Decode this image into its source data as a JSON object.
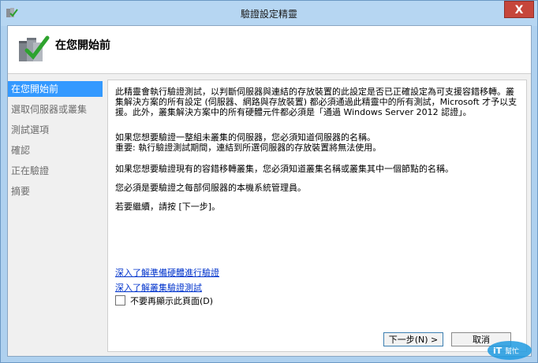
{
  "window": {
    "title": "驗證設定精靈",
    "close_label": "X"
  },
  "header": {
    "title": "在您開始前"
  },
  "nav": {
    "items": [
      {
        "label": "在您開始前"
      },
      {
        "label": "選取伺服器或叢集"
      },
      {
        "label": "測試選項"
      },
      {
        "label": "確認"
      },
      {
        "label": "正在驗證"
      },
      {
        "label": "摘要"
      }
    ]
  },
  "main": {
    "paragraph1": "此精靈會執行驗證測試，以判斷伺服器與連結的存放裝置的此設定是否已正確設定為可支援容錯移轉。叢集解決方案的所有設定 (伺服器、網路與存放裝置) 都必須通過此精靈中的所有測試，Microsoft 才予以支援。此外，叢集解決方案中的所有硬體元件都必須是「通過 Windows Server 2012 認證」。",
    "paragraph2": "如果您想要驗證一整組未叢集的伺服器，您必須知道伺服器的名稱。\n重要: 執行驗證測試期間，連結到所選伺服器的存放裝置將無法使用。",
    "paragraph3": "如果您想要驗證現有的容錯移轉叢集，您必須知道叢集名稱或叢集其中一個節點的名稱。",
    "paragraph4": "您必須是要驗證之每部伺服器的本機系統管理員。",
    "paragraph5": "若要繼續，請按 [下一步]。",
    "link1": "深入了解準備硬體進行驗證",
    "link2": "深入了解叢集驗證測試",
    "checkbox_label": "不要再顯示此頁面(D)"
  },
  "buttons": {
    "next": "下一步(N) >",
    "cancel": "取消"
  },
  "colors": {
    "frame": "#afd1ef",
    "nav_active": "#3399ff",
    "link": "#0033cc",
    "close": "#c6463b"
  }
}
